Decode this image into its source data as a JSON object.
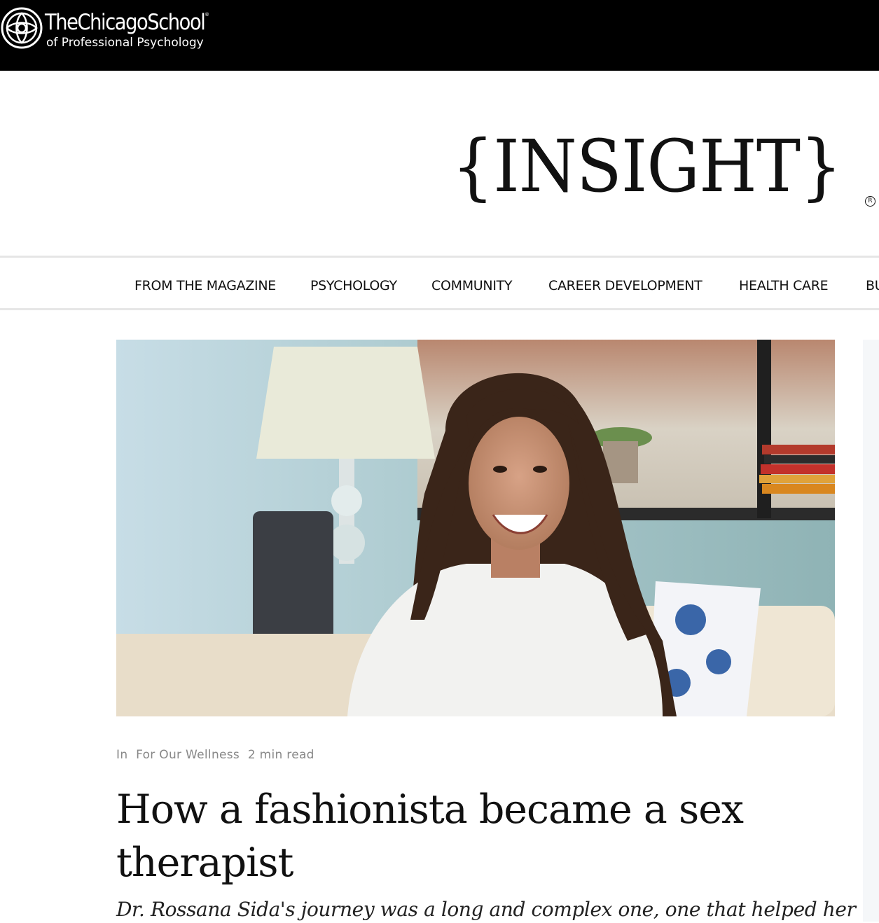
{
  "header": {
    "logo_main": "TheChicagoSchool",
    "logo_registered": "®",
    "logo_sub": "of Professional Psychology"
  },
  "masthead": {
    "title": "{INSIGHT}",
    "registered": "®"
  },
  "nav": {
    "items": [
      "FROM THE MAGAZINE",
      "PSYCHOLOGY",
      "COMMUNITY",
      "CAREER DEVELOPMENT",
      "HEALTH CARE",
      "BU"
    ]
  },
  "article": {
    "in_label": "In",
    "category": "For Our Wellness",
    "read_time": "2 min read",
    "title": "How a fashionista became a sex therapist",
    "subtitle": "Dr. Rossana Sida's journey was a long and complex one, one that helped her"
  },
  "colors": {
    "header_bg": "#000000",
    "nav_border": "#e6e6e6",
    "meta_text": "#888888",
    "title_text": "#111111"
  }
}
